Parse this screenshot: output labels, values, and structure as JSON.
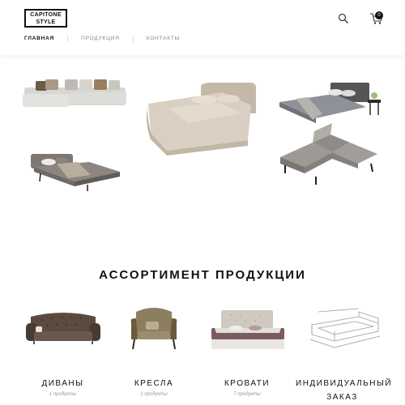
{
  "header": {
    "logo": {
      "line1": "CAPITONE",
      "line2": "STYLE"
    },
    "nav": [
      {
        "label": "ГЛАВНАЯ",
        "active": true
      },
      {
        "label": "ПРОДУКЦИЯ",
        "active": false
      },
      {
        "label": "КОНТАКТЫ",
        "active": false
      }
    ],
    "cart_count": "0"
  },
  "section": {
    "title": "АССОРТИМЕНТ ПРОДУКЦИИ"
  },
  "products": [
    {
      "name": "ДИВАНЫ",
      "count": "1 продукты"
    },
    {
      "name": "КРЕСЛА",
      "count": "1 продукты"
    },
    {
      "name": "КРОВАТИ",
      "count": "7 продукты"
    },
    {
      "name": "ИНДИВИДУАЛЬНЫЙ ЗАКАЗ",
      "count": ""
    }
  ],
  "colors": {
    "text": "#111111",
    "muted": "#888888",
    "bg": "#ffffff"
  }
}
